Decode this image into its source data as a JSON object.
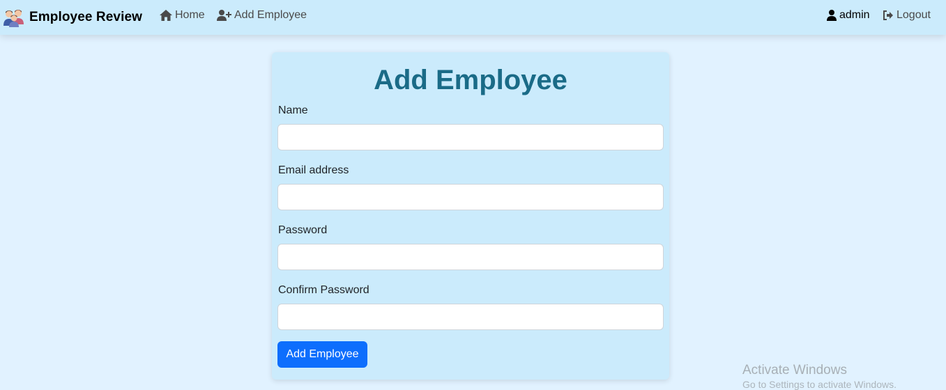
{
  "navbar": {
    "brand": "Employee Review",
    "links": {
      "home": "Home",
      "add_employee": "Add Employee",
      "user": "admin",
      "logout": "Logout"
    }
  },
  "form": {
    "title": "Add Employee",
    "fields": [
      {
        "label": "Name",
        "value": ""
      },
      {
        "label": "Email address",
        "value": ""
      },
      {
        "label": "Password",
        "value": ""
      },
      {
        "label": "Confirm Password",
        "value": ""
      }
    ],
    "submit_label": "Add Employee"
  },
  "watermark": {
    "line1": "Activate Windows",
    "line2": "Go to Settings to activate Windows."
  },
  "colors": {
    "page_bg": "#e1f2ff",
    "navbar_bg": "#cbebfc",
    "card_bg": "#cbebfc",
    "title": "#1a6b87",
    "primary": "#0d6efd"
  }
}
